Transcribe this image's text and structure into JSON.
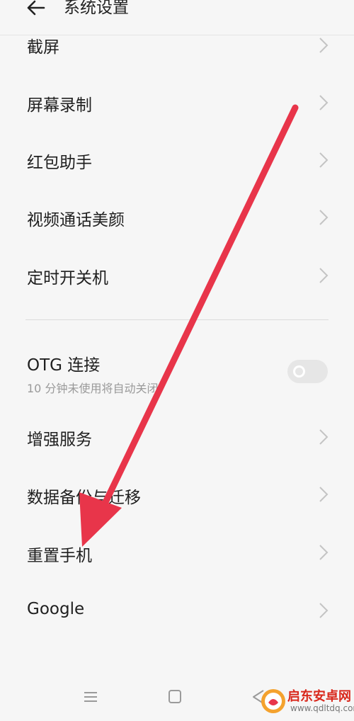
{
  "header": {
    "title": "系统设置",
    "back_icon": "arrow-left-icon"
  },
  "items": [
    {
      "label": "截屏"
    },
    {
      "label": "屏幕录制"
    },
    {
      "label": "红包助手"
    },
    {
      "label": "视频通话美颜"
    },
    {
      "label": "定时开关机"
    },
    {
      "label": "OTG 连接",
      "subtitle": "10 分钟未使用将自动关闭",
      "toggle_on": false
    },
    {
      "label": "增强服务"
    },
    {
      "label": "数据备份与迁移"
    },
    {
      "label": "重置手机"
    },
    {
      "label": "Google"
    }
  ],
  "annotation": {
    "arrow_color": "#e8354a"
  },
  "watermark": {
    "main": "启东安卓网",
    "sub": "www.qdltdq.com"
  },
  "colors": {
    "background": "#f6f6f6",
    "text": "#1f1f1f",
    "chevron": "#c4c4c4"
  }
}
